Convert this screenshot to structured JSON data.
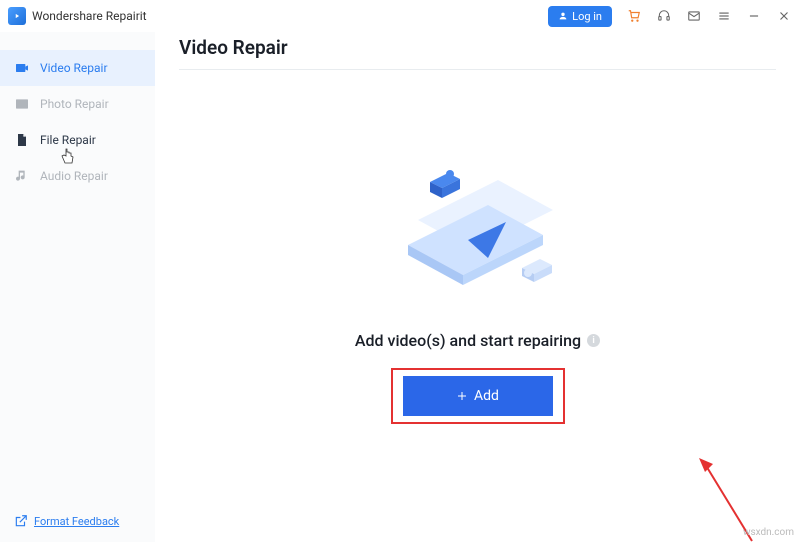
{
  "titlebar": {
    "app_name": "Wondershare Repairit",
    "login_label": "Log in"
  },
  "sidebar": {
    "items": [
      {
        "label": "Video Repair"
      },
      {
        "label": "Photo Repair"
      },
      {
        "label": "File Repair"
      },
      {
        "label": "Audio Repair"
      }
    ],
    "feedback_label": "Format Feedback"
  },
  "main": {
    "title": "Video Repair",
    "hint": "Add video(s) and start repairing",
    "add_label": "Add"
  },
  "watermark": "wsxdn.com"
}
